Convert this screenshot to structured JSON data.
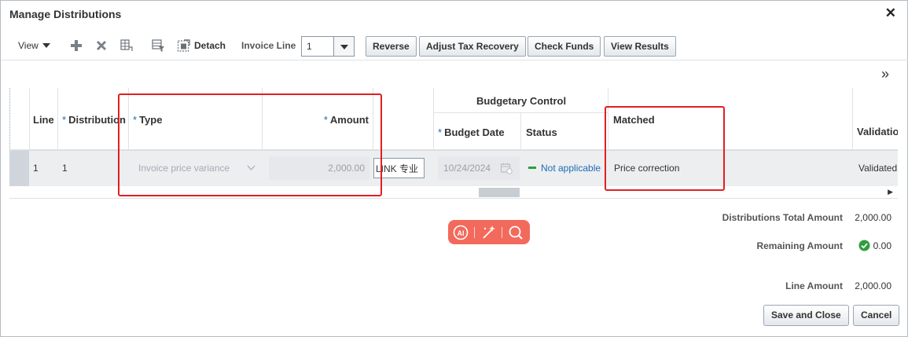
{
  "dialog": {
    "title": "Manage Distributions",
    "close_icon": "close-icon"
  },
  "toolbar": {
    "view_label": "View",
    "icons": [
      "add-icon",
      "delete-icon",
      "split-icon",
      "query-by-example-icon",
      "detach-icon"
    ],
    "detach_label": "Detach",
    "invoice_line_label": "Invoice Line",
    "invoice_line_value": "1",
    "buttons": [
      "Reverse",
      "Adjust Tax Recovery",
      "Check Funds",
      "View Results"
    ]
  },
  "table": {
    "group_header": "Budgetary Control",
    "headers": {
      "line": "Line",
      "distribution": "Distribution",
      "type": "Type",
      "amount": "Amount",
      "budget_date": "Budget Date",
      "status": "Status",
      "matched": "Matched",
      "validation": "Validatio"
    },
    "required_marker": "*",
    "row": {
      "line": "1",
      "distribution": "1",
      "type": "Invoice price variance",
      "amount": "2,000.00",
      "link_text": "LINK 专业",
      "budget_date": "10/24/2024",
      "status": "Not applicable",
      "matched": "Price correction",
      "validation": "Validated"
    }
  },
  "summary": {
    "distributions_total_label": "Distributions Total Amount",
    "distributions_total_value": "2,000.00",
    "remaining_label": "Remaining Amount",
    "remaining_value": "0.00",
    "line_amount_label": "Line Amount",
    "line_amount_value": "2,000.00"
  },
  "footer": {
    "save_close": "Save and Close",
    "cancel": "Cancel"
  },
  "colors": {
    "highlight": "#e02020",
    "accent": "#1f6bb5",
    "status_ok": "#2e9e3e",
    "ai_bar": "#f26a5c"
  }
}
